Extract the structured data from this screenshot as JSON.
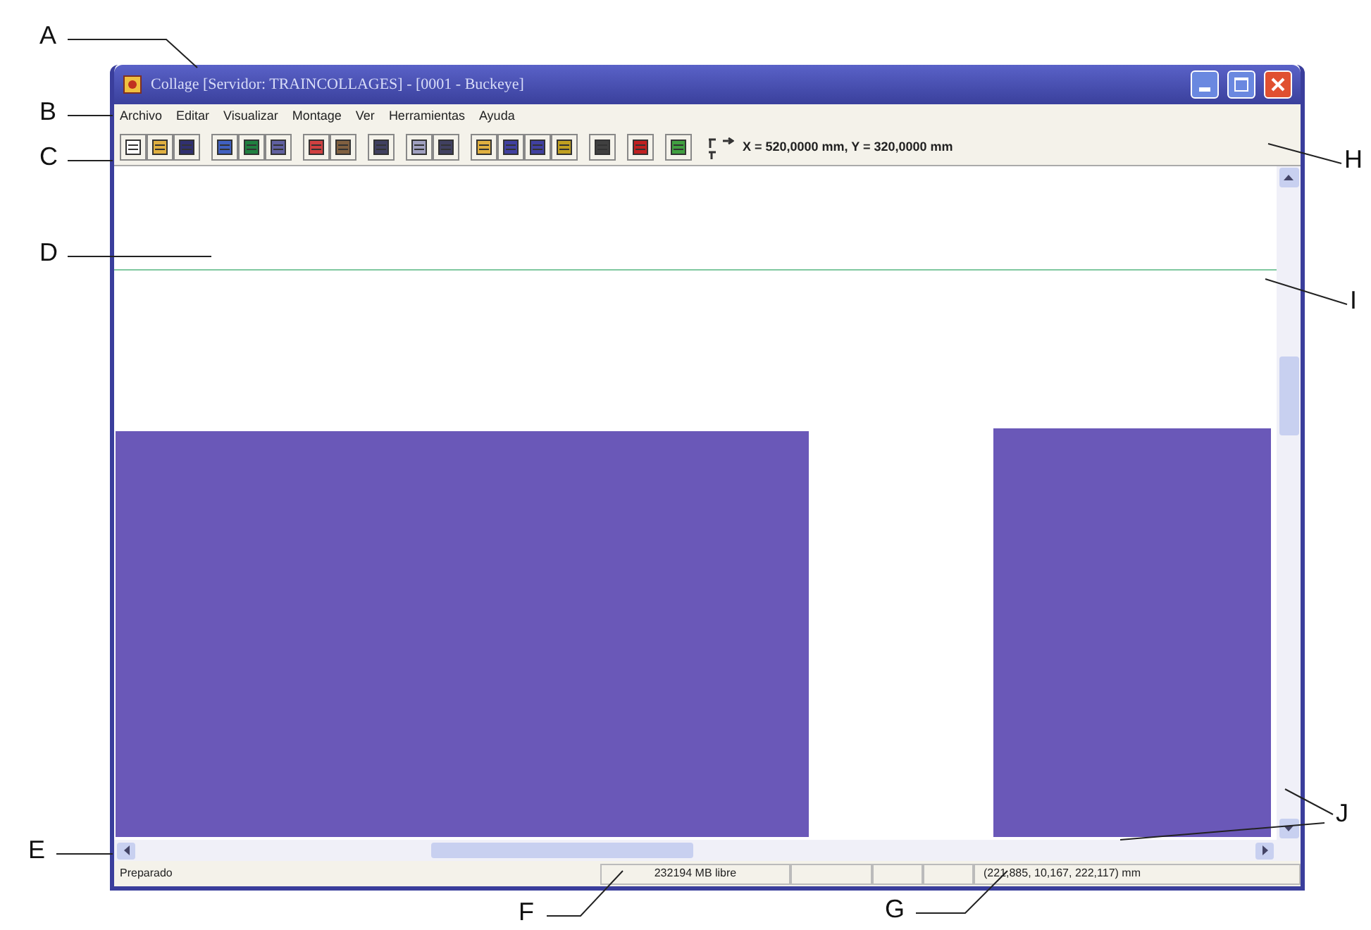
{
  "callouts": [
    {
      "label": "A"
    },
    {
      "label": "B"
    },
    {
      "label": "C"
    },
    {
      "label": "D"
    },
    {
      "label": "E"
    },
    {
      "label": "F"
    },
    {
      "label": "G"
    },
    {
      "label": "H"
    },
    {
      "label": "I"
    },
    {
      "label": "J"
    }
  ],
  "window": {
    "title": "Collage  [Servidor: TRAINCOLLAGES] - [0001 - Buckeye]"
  },
  "menu": [
    "Archivo",
    "Editar",
    "Visualizar",
    "Montage",
    "Ver",
    "Herramientas",
    "Ayuda"
  ],
  "toolbar": {
    "coordinates": "X = 520,0000 mm, Y = 320,0000 mm"
  },
  "status_bar": {
    "message": "Preparado",
    "memory": "232194 MB libre",
    "extent": "(221,885, 10,167, 222,117) mm"
  }
}
